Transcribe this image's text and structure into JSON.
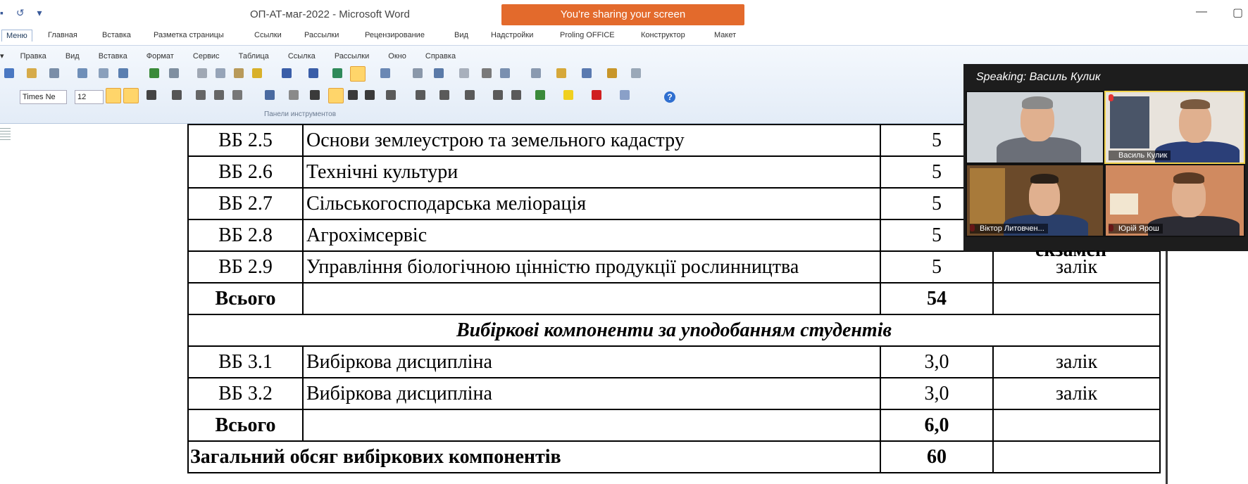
{
  "window": {
    "title": "ОП-АТ-маг-2022 - Microsoft Word",
    "share_banner": "You're sharing your screen"
  },
  "ribbon_tabs": [
    "Меню",
    "Главная",
    "Вставка",
    "Разметка страницы",
    "Ссылки",
    "Рассылки",
    "Рецензирование",
    "Вид",
    "Надстройки",
    "Proling OFFICE",
    "Конструктор",
    "Макет"
  ],
  "menu_bar": [
    "Правка",
    "Вид",
    "Вставка",
    "Формат",
    "Сервис",
    "Таблица",
    "Ссылка",
    "Рассылки",
    "Окно",
    "Справка"
  ],
  "toolbar": {
    "font_name": "Times Ne",
    "font_size": "12",
    "panel_caption": "Панели инструментов"
  },
  "table": {
    "rows": [
      {
        "type": "item",
        "code": "ВБ 2.5",
        "name": "Основи землеустрою та земельного кадастру",
        "credits": "5",
        "control": ""
      },
      {
        "type": "item",
        "code": "ВБ 2.6",
        "name": "Технічні культури",
        "credits": "5",
        "control": ""
      },
      {
        "type": "item",
        "code": "ВБ 2.7",
        "name": "Сільськогосподарська меліорація",
        "credits": "5",
        "control": ""
      },
      {
        "type": "item",
        "code": "ВБ 2.8",
        "name": "Агрохімсервіс",
        "credits": "5",
        "control": ""
      },
      {
        "type": "item",
        "code": "ВБ 2.9",
        "name": "Управління біологічною цінністю продукції рослинництва",
        "credits": "5",
        "control": "залік"
      },
      {
        "type": "total",
        "code": "Всього",
        "name": "",
        "credits": "54",
        "control": ""
      },
      {
        "type": "section",
        "title": "Вибіркові компоненти за уподобанням студентів"
      },
      {
        "type": "item",
        "code": "ВБ 3.1",
        "name": "Вибіркова дисципліна",
        "credits": "3,0",
        "control": "залік"
      },
      {
        "type": "item",
        "code": "ВБ 3.2",
        "name": "Вибіркова дисципліна",
        "credits": "3,0",
        "control": "залік"
      },
      {
        "type": "total",
        "code": "Всього",
        "name": "",
        "credits": "6,0",
        "control": ""
      },
      {
        "type": "grand",
        "label": "Загальний обсяг вибіркових компонентів",
        "credits": "60",
        "control": ""
      }
    ],
    "partially_hidden_text": "екзамен"
  },
  "video_panel": {
    "speaking_label": "Speaking: Василь Кулик",
    "participants": [
      {
        "name": "",
        "wall": "#cfd4d8",
        "shirt": "#6b6f78",
        "hair": "#8a8a8a"
      },
      {
        "name": "Василь Кулик",
        "wall": "#e8e3dc",
        "shirt": "#2b3f78",
        "hair": "#7a5a40"
      },
      {
        "name": "Віктор Литовчен...",
        "wall": "#6b4a2a",
        "shirt": "#2a3f6a",
        "hair": "#2a2018"
      },
      {
        "name": "Юрій Ярош",
        "wall": "#d08a60",
        "shirt": "#2c2c34",
        "hair": "#5a3a24"
      }
    ]
  }
}
